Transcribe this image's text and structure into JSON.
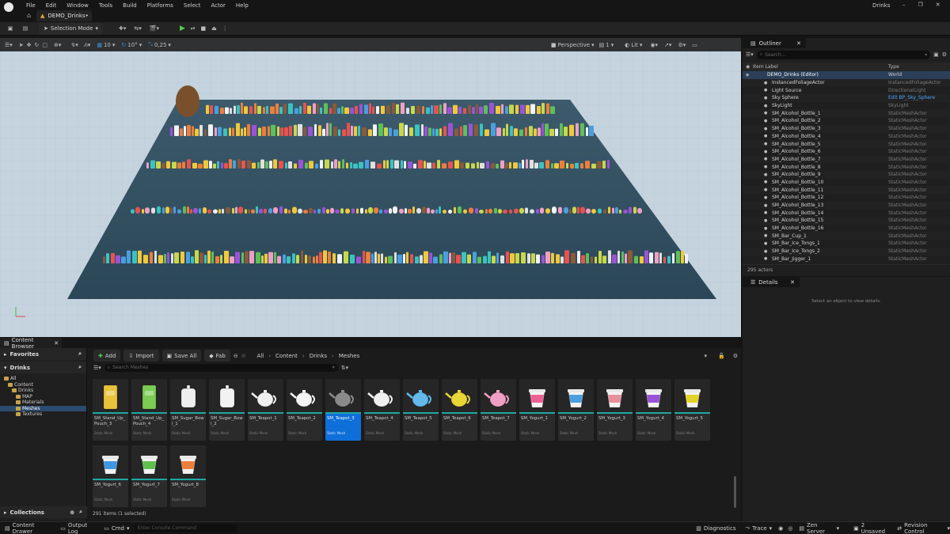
{
  "window": {
    "title": "Drinks",
    "level_tab": "DEMO_Drinks•",
    "menu": [
      "File",
      "Edit",
      "Window",
      "Tools",
      "Build",
      "Platforms",
      "Select",
      "Actor",
      "Help"
    ]
  },
  "toolbar": {
    "mode": "Selection Mode"
  },
  "viewport": {
    "grid_snap": "10",
    "rotation_snap": "10°",
    "scale_snap": "0,25",
    "view_mode_perspective": "Perspective",
    "view_mode_lit": "Lit",
    "camera_speed": "1"
  },
  "outliner": {
    "tab": "Outliner",
    "search_placeholder": "Search...",
    "col_label": "Item Label",
    "col_type": "Type",
    "rows": [
      {
        "label": "DEMO_Drinks (Editor)",
        "type": "World"
      },
      {
        "label": "InstancedFoliageActor",
        "type": "InstancedFoliageActor"
      },
      {
        "label": "Light Source",
        "type": "DirectionalLight"
      },
      {
        "label": "Sky Sphere",
        "type": "Edit BP_Sky_Sphere"
      },
      {
        "label": "SkyLight",
        "type": "SkyLight"
      },
      {
        "label": "SM_Alcohol_Bottle_1",
        "type": "StaticMeshActor"
      },
      {
        "label": "SM_Alcohol_Bottle_2",
        "type": "StaticMeshActor"
      },
      {
        "label": "SM_Alcohol_Bottle_3",
        "type": "StaticMeshActor"
      },
      {
        "label": "SM_Alcohol_Bottle_4",
        "type": "StaticMeshActor"
      },
      {
        "label": "SM_Alcohol_Bottle_5",
        "type": "StaticMeshActor"
      },
      {
        "label": "SM_Alcohol_Bottle_6",
        "type": "StaticMeshActor"
      },
      {
        "label": "SM_Alcohol_Bottle_7",
        "type": "StaticMeshActor"
      },
      {
        "label": "SM_Alcohol_Bottle_8",
        "type": "StaticMeshActor"
      },
      {
        "label": "SM_Alcohol_Bottle_9",
        "type": "StaticMeshActor"
      },
      {
        "label": "SM_Alcohol_Bottle_10",
        "type": "StaticMeshActor"
      },
      {
        "label": "SM_Alcohol_Bottle_11",
        "type": "StaticMeshActor"
      },
      {
        "label": "SM_Alcohol_Bottle_12",
        "type": "StaticMeshActor"
      },
      {
        "label": "SM_Alcohol_Bottle_13",
        "type": "StaticMeshActor"
      },
      {
        "label": "SM_Alcohol_Bottle_14",
        "type": "StaticMeshActor"
      },
      {
        "label": "SM_Alcohol_Bottle_15",
        "type": "StaticMeshActor"
      },
      {
        "label": "SM_Alcohol_Bottle_16",
        "type": "StaticMeshActor"
      },
      {
        "label": "SM_Bar_Cup_1",
        "type": "StaticMeshActor"
      },
      {
        "label": "SM_Bar_Ice_Tongs_1",
        "type": "StaticMeshActor"
      },
      {
        "label": "SM_Bar_Ice_Tongs_2",
        "type": "StaticMeshActor"
      },
      {
        "label": "SM_Bar_Jigger_1",
        "type": "StaticMeshActor"
      }
    ],
    "actor_count": "295 actors"
  },
  "details": {
    "tab": "Details",
    "empty_text": "Select an object to view details."
  },
  "content_browser": {
    "tab": "Content Browser",
    "add_label": "Add",
    "import_label": "Import",
    "save_all_label": "Save All",
    "fab_label": "Fab",
    "breadcrumb": [
      "All",
      "Content",
      "Drinks",
      "Meshes"
    ],
    "search_placeholder": "Search Meshes",
    "favorites_label": "Favorites",
    "drinks_label": "Drinks",
    "collections_label": "Collections",
    "tree": [
      {
        "label": "All",
        "indent": 0
      },
      {
        "label": "Content",
        "indent": 1
      },
      {
        "label": "Drinks",
        "indent": 2
      },
      {
        "label": "MAP",
        "indent": 3
      },
      {
        "label": "Materials",
        "indent": 3
      },
      {
        "label": "Meshes",
        "indent": 3
      },
      {
        "label": "Textures",
        "indent": 3
      }
    ],
    "assets": [
      {
        "name": "SM_Stand_Up_Pouch_3",
        "type": "Static Mesh",
        "icon": "pouch-icon",
        "color": "#e9c23b"
      },
      {
        "name": "SM_Stand_Up_Pouch_4",
        "type": "Static Mesh",
        "icon": "pouch-icon",
        "color": "#7bcb55"
      },
      {
        "name": "SM_Sugar_Bowl_1",
        "type": "Static Mesh",
        "icon": "bowl-icon",
        "color": "#eeeeee"
      },
      {
        "name": "SM_Sugar_Bowl_2",
        "type": "Static Mesh",
        "icon": "bowl-icon",
        "color": "#f2f2f2"
      },
      {
        "name": "SM_Teapot_1",
        "type": "Static Mesh",
        "icon": "teapot-icon",
        "color": "#f0f0f0"
      },
      {
        "name": "SM_Teapot_2",
        "type": "Static Mesh",
        "icon": "teapot-icon",
        "color": "#f4f4f4"
      },
      {
        "name": "SM_Teapot_3",
        "type": "Static Mesh",
        "icon": "teapot-icon",
        "color": "#8a8a8a"
      },
      {
        "name": "SM_Teapot_4",
        "type": "Static Mesh",
        "icon": "teapot-icon",
        "color": "#f0f0f0"
      },
      {
        "name": "SM_Teapot_5",
        "type": "Static Mesh",
        "icon": "teapot-icon",
        "color": "#62b9ea"
      },
      {
        "name": "SM_Teapot_6",
        "type": "Static Mesh",
        "icon": "teapot-icon",
        "color": "#e8d637"
      },
      {
        "name": "SM_Teapot_7",
        "type": "Static Mesh",
        "icon": "teapot-icon",
        "color": "#ef9fc4"
      },
      {
        "name": "SM_Yogurt_1",
        "type": "Static Mesh",
        "icon": "yogurt-icon",
        "color": "#ee5f95"
      },
      {
        "name": "SM_Yogurt_2",
        "type": "Static Mesh",
        "icon": "yogurt-icon",
        "color": "#4a9fe0"
      },
      {
        "name": "SM_Yogurt_3",
        "type": "Static Mesh",
        "icon": "yogurt-icon",
        "color": "#e88f9d"
      },
      {
        "name": "SM_Yogurt_4",
        "type": "Static Mesh",
        "icon": "yogurt-icon",
        "color": "#9b53d6"
      },
      {
        "name": "SM_Yogurt_5",
        "type": "Static Mesh",
        "icon": "yogurt-icon",
        "color": "#e3d227"
      },
      {
        "name": "SM_Yogurt_6",
        "type": "Static Mesh",
        "icon": "yogurt-icon",
        "color": "#3e98e3"
      },
      {
        "name": "SM_Yogurt_7",
        "type": "Static Mesh",
        "icon": "yogurt-icon",
        "color": "#5fc04e"
      },
      {
        "name": "SM_Yogurt_8",
        "type": "Static Mesh",
        "icon": "yogurt-icon",
        "color": "#ee7e3c"
      }
    ],
    "selected_asset": "SM_Teapot_3",
    "item_count": "291 items (1 selected)"
  },
  "statusbar": {
    "content_drawer": "Content Drawer",
    "output_log": "Output Log",
    "cmd": "Cmd",
    "console_placeholder": "Enter Console Command",
    "diagnostics": "Diagnostics",
    "trace": "Trace",
    "zen_server": "Zen Server",
    "unsaved": "2 Unsaved",
    "revision_control": "Revision Control"
  },
  "colors": {
    "accent": "#1fa7a2",
    "selection": "#0f6fd8",
    "play": "#4fcf4f"
  }
}
